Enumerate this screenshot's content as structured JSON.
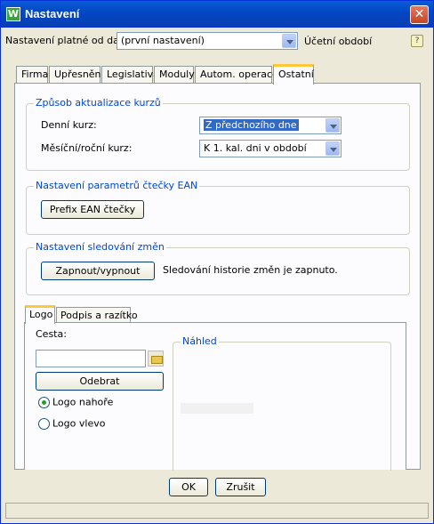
{
  "window": {
    "title": "Nastavení",
    "app_icon": "W"
  },
  "top": {
    "label": "Nastavení platné od data:",
    "select_value": "(první nastavení)",
    "side_label": "Účetní období",
    "help_icon": "help-icon"
  },
  "tabs": [
    {
      "label": "Firma"
    },
    {
      "label": "Upřesnění"
    },
    {
      "label": "Legislativa"
    },
    {
      "label": "Moduly"
    },
    {
      "label": "Autom. operace"
    },
    {
      "label": "Ostatní",
      "active": true
    }
  ],
  "rates": {
    "title": "Způsob aktualizace kurzů",
    "daily_label": "Denní kurz:",
    "daily_value": "Z předchozího dne",
    "monthly_label": "Měsíční/roční kurz:",
    "monthly_value": "K 1. kal. dni v období"
  },
  "ean": {
    "title": "Nastavení parametrů čtečky EAN",
    "button": "Prefix EAN čtečky"
  },
  "tracking": {
    "title": "Nastavení sledování změn",
    "button": "Zapnout/vypnout",
    "status": "Sledování historie změn je zapnuto."
  },
  "subtabs": [
    {
      "label": "Logo",
      "active": true
    },
    {
      "label": "Podpis a razítko"
    }
  ],
  "logo": {
    "path_label": "Cesta:",
    "path_value": "",
    "remove_button": "Odebrat",
    "radio_top": "Logo nahoře",
    "radio_left": "Logo vlevo",
    "selected": "top",
    "preview_title": "Náhled"
  },
  "footer": {
    "ok": "OK",
    "cancel": "Zrušit"
  }
}
